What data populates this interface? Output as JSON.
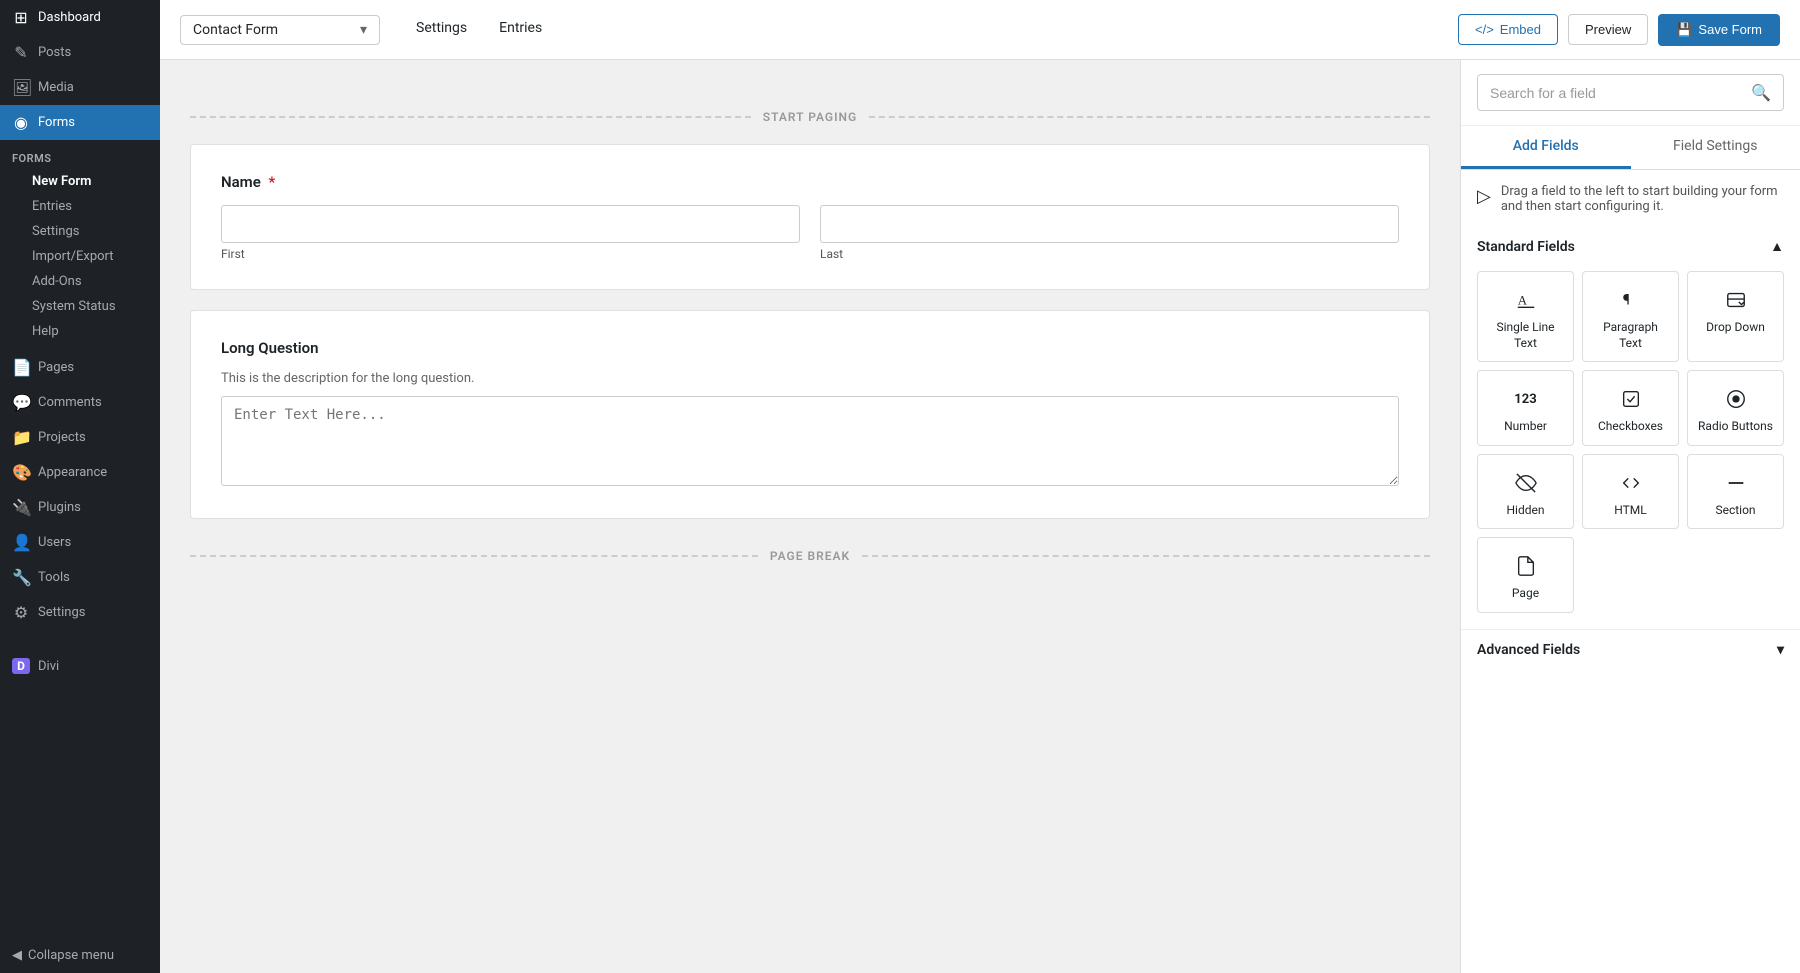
{
  "sidebar": {
    "items": [
      {
        "id": "dashboard",
        "label": "Dashboard",
        "icon": "⊞"
      },
      {
        "id": "posts",
        "label": "Posts",
        "icon": "✎"
      },
      {
        "id": "media",
        "label": "Media",
        "icon": "🖼"
      },
      {
        "id": "forms",
        "label": "Forms",
        "icon": "◉",
        "active": true
      }
    ],
    "forms_sub": [
      {
        "id": "forms",
        "label": "Forms"
      },
      {
        "id": "new-form",
        "label": "New Form"
      },
      {
        "id": "entries",
        "label": "Entries"
      },
      {
        "id": "settings",
        "label": "Settings"
      },
      {
        "id": "import-export",
        "label": "Import/Export"
      },
      {
        "id": "add-ons",
        "label": "Add-Ons"
      },
      {
        "id": "system-status",
        "label": "System Status"
      },
      {
        "id": "help",
        "label": "Help"
      }
    ],
    "more_items": [
      {
        "id": "pages",
        "label": "Pages",
        "icon": "📄"
      },
      {
        "id": "comments",
        "label": "Comments",
        "icon": "💬"
      },
      {
        "id": "projects",
        "label": "Projects",
        "icon": "📁"
      },
      {
        "id": "appearance",
        "label": "Appearance",
        "icon": "🎨"
      },
      {
        "id": "plugins",
        "label": "Plugins",
        "icon": "🔌"
      },
      {
        "id": "users",
        "label": "Users",
        "icon": "👤"
      },
      {
        "id": "tools",
        "label": "Tools",
        "icon": "🔧"
      },
      {
        "id": "settings",
        "label": "Settings",
        "icon": "⚙"
      }
    ],
    "divi": {
      "label": "Divi",
      "icon": "D"
    },
    "collapse_label": "Collapse menu"
  },
  "topbar": {
    "form_name": "Contact Form",
    "chevron": "▾",
    "tabs": [
      {
        "id": "settings",
        "label": "Settings"
      },
      {
        "id": "entries",
        "label": "Entries"
      }
    ],
    "embed_label": "Embed",
    "embed_icon": "</>",
    "preview_label": "Preview",
    "save_label": "Save Form",
    "save_icon": "💾"
  },
  "canvas": {
    "start_paging_label": "START PAGING",
    "page_break_label": "PAGE BREAK",
    "name_field": {
      "label": "Name",
      "required": true,
      "inputs": [
        {
          "id": "first",
          "sub_label": "First",
          "placeholder": ""
        },
        {
          "id": "last",
          "sub_label": "Last",
          "placeholder": ""
        }
      ]
    },
    "long_question_field": {
      "label": "Long Question",
      "description": "This is the description for the long question.",
      "placeholder": "Enter Text Here..."
    }
  },
  "right_panel": {
    "search_placeholder": "Search for a field",
    "search_icon": "🔍",
    "tabs": [
      {
        "id": "add-fields",
        "label": "Add Fields",
        "active": true
      },
      {
        "id": "field-settings",
        "label": "Field Settings"
      }
    ],
    "drag_hint": "Drag a field to the left to start building your form and then start configuring it.",
    "standard_fields_label": "Standard Fields",
    "fields": [
      {
        "id": "single-line-text",
        "label": "Single Line Text",
        "icon": "A"
      },
      {
        "id": "paragraph-text",
        "label": "Paragraph Text",
        "icon": "¶"
      },
      {
        "id": "drop-down",
        "label": "Drop Down",
        "icon": "⊡"
      },
      {
        "id": "number",
        "label": "Number",
        "icon": "123"
      },
      {
        "id": "checkboxes",
        "label": "Checkboxes",
        "icon": "☑"
      },
      {
        "id": "radio-buttons",
        "label": "Radio Buttons",
        "icon": "◎"
      },
      {
        "id": "hidden",
        "label": "Hidden",
        "icon": "👁"
      },
      {
        "id": "html",
        "label": "HTML",
        "icon": "<>"
      },
      {
        "id": "section",
        "label": "Section",
        "icon": "—"
      },
      {
        "id": "page",
        "label": "Page",
        "icon": "📄"
      }
    ],
    "advanced_fields_label": "Advanced Fields",
    "collapse_icon": "▲",
    "expand_icon": "▾"
  }
}
